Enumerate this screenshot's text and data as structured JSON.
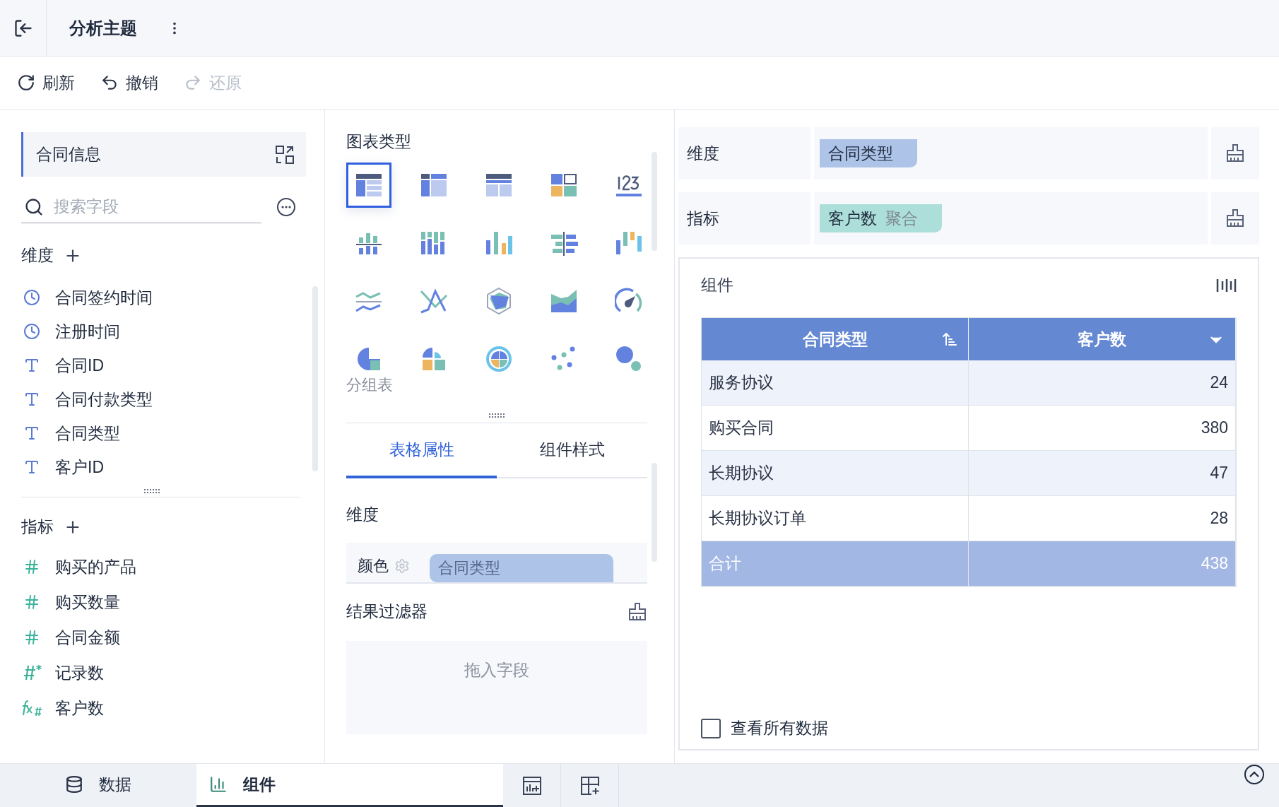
{
  "header": {
    "title": "分析主题"
  },
  "toolbar": [
    {
      "label": "刷新",
      "kind": "refresh",
      "disabled": false
    },
    {
      "label": "撤销",
      "kind": "undo",
      "disabled": false
    },
    {
      "label": "还原",
      "kind": "redo",
      "disabled": true
    }
  ],
  "fields_panel": {
    "dataset": "合同信息",
    "search": {
      "placeholder": "搜索字段"
    },
    "dimensions": {
      "title": "维度",
      "fields": [
        {
          "name": "合同签约时间",
          "kind": "date"
        },
        {
          "name": "注册时间",
          "kind": "date"
        },
        {
          "name": "合同ID",
          "kind": "text"
        },
        {
          "name": "合同付款类型",
          "kind": "text"
        },
        {
          "name": "合同类型",
          "kind": "text"
        },
        {
          "name": "客户ID",
          "kind": "text"
        }
      ]
    },
    "measures": {
      "title": "指标",
      "fields": [
        {
          "name": "购买的产品",
          "kind": "number"
        },
        {
          "name": "购买数量",
          "kind": "number"
        },
        {
          "name": "合同金额",
          "kind": "number"
        },
        {
          "name": "记录数",
          "kind": "count"
        },
        {
          "name": "客户数",
          "kind": "calc"
        }
      ]
    }
  },
  "chart_types": {
    "title": "图表类型",
    "hover_label": "分组表",
    "items": [
      {
        "kind": "group-table",
        "selected": true
      },
      {
        "kind": "cross-table",
        "selected": false
      },
      {
        "kind": "detail-table",
        "selected": false
      },
      {
        "kind": "blocks",
        "selected": false
      },
      {
        "kind": "number",
        "selected": false
      },
      {
        "kind": "diverging-bar",
        "selected": false
      },
      {
        "kind": "stacked-column",
        "selected": false
      },
      {
        "kind": "column",
        "selected": false
      },
      {
        "kind": "butterfly",
        "selected": false
      },
      {
        "kind": "waterfall",
        "selected": false
      },
      {
        "kind": "multi-line",
        "selected": false
      },
      {
        "kind": "line",
        "selected": false
      },
      {
        "kind": "radar",
        "selected": false
      },
      {
        "kind": "area",
        "selected": false
      },
      {
        "kind": "gauge",
        "selected": false
      },
      {
        "kind": "pie",
        "selected": false
      },
      {
        "kind": "rose",
        "selected": false
      },
      {
        "kind": "sunburst",
        "selected": false
      },
      {
        "kind": "scatter",
        "selected": false
      },
      {
        "kind": "bubble",
        "selected": false
      }
    ]
  },
  "property_tabs": [
    {
      "label": "表格属性",
      "selected": true
    },
    {
      "label": "组件样式",
      "selected": false
    }
  ],
  "properties": {
    "title": "维度",
    "color_label": "颜色",
    "color_chip": "合同类型"
  },
  "result_filter": {
    "title": "结果过滤器",
    "placeholder": "拖入字段"
  },
  "shelves": [
    {
      "label": "维度",
      "kind": "dimension",
      "chip": "合同类型"
    },
    {
      "label": "指标",
      "kind": "measure",
      "chip": "客户数",
      "suffix": "聚合"
    }
  ],
  "component": {
    "title": "组件",
    "table": {
      "columns": [
        "合同类型",
        "客户数"
      ],
      "rows": [
        [
          "服务协议",
          "24"
        ],
        [
          "购买合同",
          "380"
        ],
        [
          "长期协议",
          "47"
        ],
        [
          "长期协议订单",
          "28"
        ]
      ],
      "total": [
        "合计",
        "438"
      ]
    },
    "show_all": {
      "label": "查看所有数据",
      "checked": false
    }
  },
  "bottom_tabs": [
    {
      "label": "数据",
      "kind": "data",
      "selected": false
    },
    {
      "label": "组件",
      "kind": "chart",
      "selected": true
    }
  ]
}
